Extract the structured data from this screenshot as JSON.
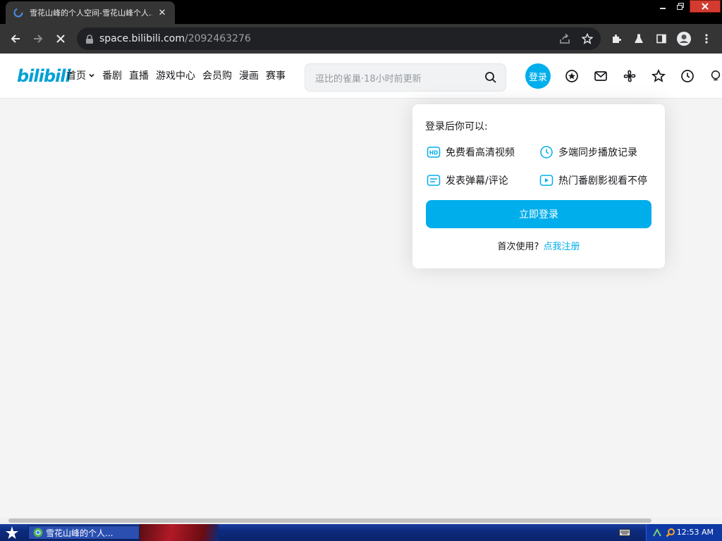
{
  "browser": {
    "tab_title": "雪花山峰的个人空间-雪花山峰个人...",
    "tab_close": "✕",
    "url_host": "space.bilibili.com",
    "url_path": "/2092463276"
  },
  "site": {
    "logo_text": "bilibili",
    "nav": [
      "首页",
      "番剧",
      "直播",
      "游戏中心",
      "会员购",
      "漫画",
      "赛事"
    ],
    "search_placeholder": "逗比的雀巢·18小时前更新",
    "login_avatar_label": "登录"
  },
  "popover": {
    "title": "登录后你可以:",
    "benefits": [
      "免费看高清视频",
      "多端同步播放记录",
      "发表弹幕/评论",
      "热门番剧影视看不停"
    ],
    "login_button": "立即登录",
    "first_use_text": "首次使用?",
    "register_link": "点我注册"
  },
  "taskbar": {
    "task_title": "雪花山峰的个人...",
    "clock": "12:53 AM"
  },
  "colors": {
    "brand": "#00aeec",
    "chrome_dark": "#353535",
    "page_bg": "#f4f4f4"
  }
}
